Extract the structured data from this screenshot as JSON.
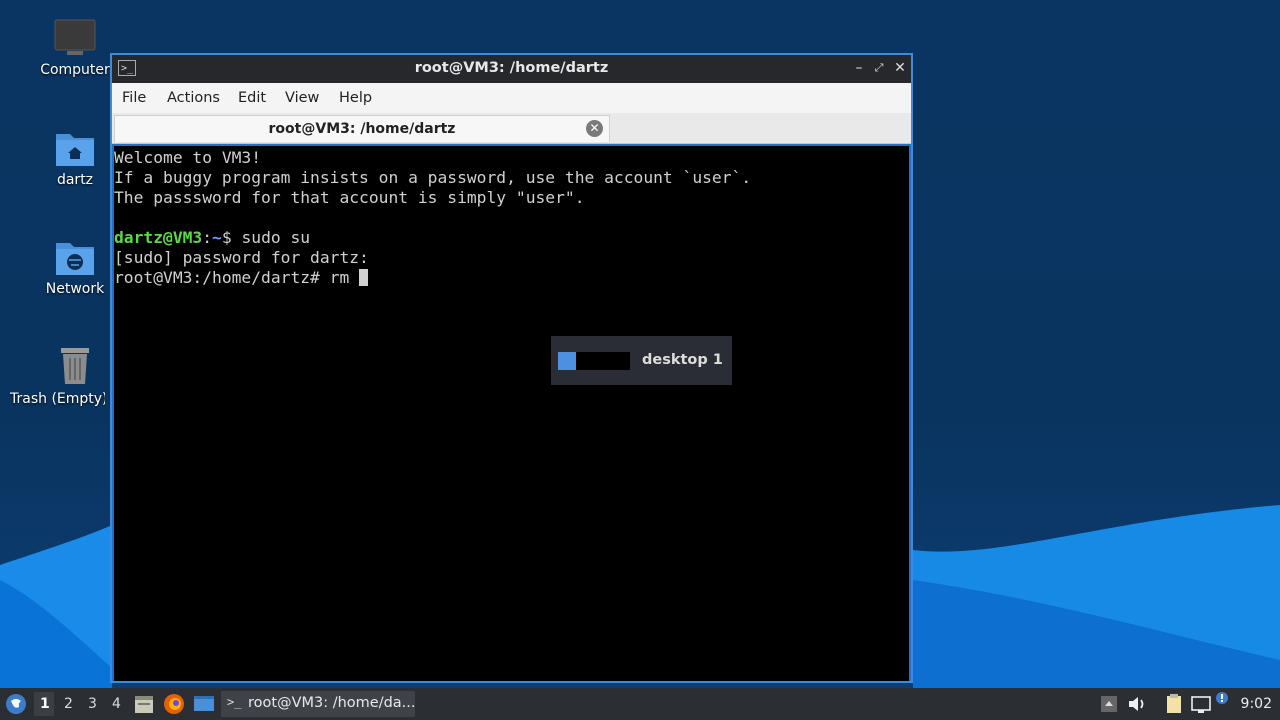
{
  "desktop": {
    "icons": [
      {
        "label": "Computer",
        "icon": "computer-icon"
      },
      {
        "label": "dartz",
        "icon": "home-folder-icon"
      },
      {
        "label": "Network",
        "icon": "network-folder-icon"
      },
      {
        "label": "Trash (Empty)",
        "icon": "trash-icon"
      }
    ]
  },
  "window": {
    "title": "root@VM3: /home/dartz",
    "menu": [
      "File",
      "Actions",
      "Edit",
      "View",
      "Help"
    ],
    "tab_label": "root@VM3: /home/dartz",
    "terminal": {
      "line1": "Welcome to VM3!",
      "line2": "If a buggy program insists on a password, use the account `user`.",
      "line3": "The passsword for that account is simply \"user\".",
      "prompt_user": "dartz@VM3",
      "prompt_sep": ":",
      "prompt_path": "~",
      "prompt_sym": "$ ",
      "command1": "sudo su",
      "line5": "[sudo] password for dartz:",
      "line6": "root@VM3:/home/dartz# rm "
    }
  },
  "osd": {
    "label": "desktop 1",
    "desktops": 4,
    "active": 1
  },
  "taskbar": {
    "workspaces": [
      "1",
      "2",
      "3",
      "4"
    ],
    "active_workspace": "1",
    "task_label": "root@VM3: /home/da...",
    "clock": "9:02"
  },
  "colors": {
    "accent": "#4d8fe0",
    "prompt_user": "#5fd74a",
    "prompt_path": "#6f9bff"
  }
}
